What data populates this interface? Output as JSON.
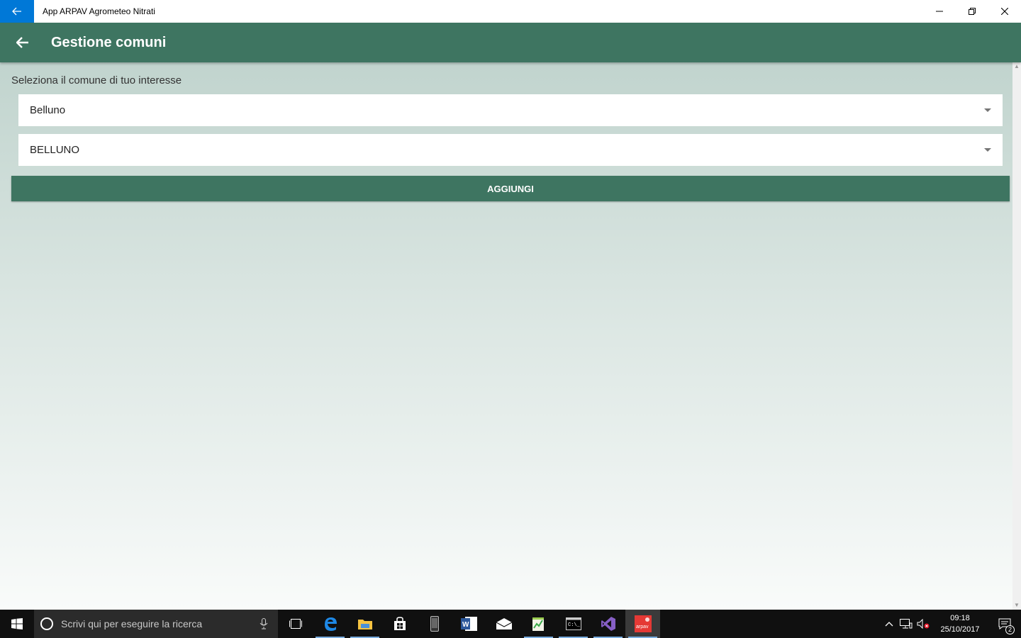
{
  "window": {
    "title": "App ARPAV Agrometeo Nitrati"
  },
  "appbar": {
    "title": "Gestione comuni"
  },
  "form": {
    "label": "Seleziona il comune di tuo interesse",
    "province_value": "Belluno",
    "comune_value": "BELLUNO",
    "add_button": "AGGIUNGI"
  },
  "taskbar": {
    "search_placeholder": "Scrivi qui per eseguire la ricerca",
    "apps": [
      "task-view",
      "edge",
      "file-explorer",
      "store",
      "phone",
      "word",
      "mail",
      "notepad-chart",
      "terminal",
      "visual-studio",
      "arpav-app"
    ],
    "clock_time": "09:18",
    "clock_date": "25/10/2017",
    "notification_count": "2"
  },
  "colors": {
    "accent_green": "#3e7561",
    "titlebar_blue": "#0078d7"
  }
}
